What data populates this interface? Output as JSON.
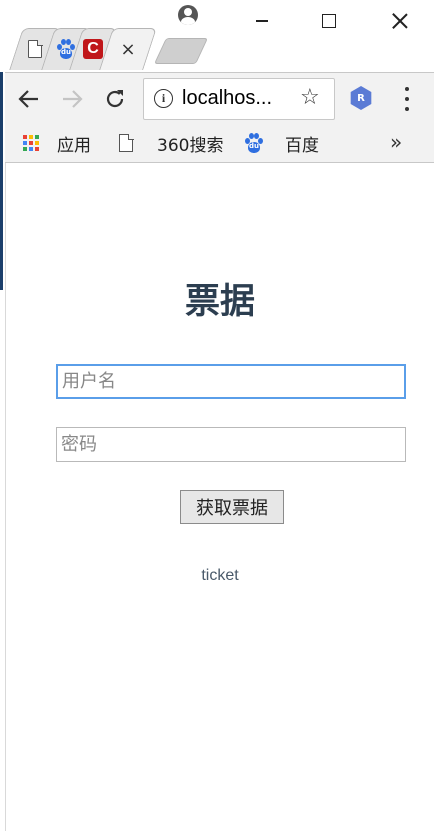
{
  "browser": {
    "url": "localhos...",
    "extension_label": "R",
    "window_controls": [
      "minimize",
      "maximize",
      "close"
    ],
    "tabs": [
      {
        "icon": "file-icon"
      },
      {
        "icon": "baidu-paw-icon"
      },
      {
        "icon": "c-logo-icon"
      },
      {
        "icon": "active-tab",
        "close_label": "×"
      }
    ],
    "bookmarks": [
      {
        "icon": "apps-grid-icon",
        "label": "应用"
      },
      {
        "icon": "file-icon",
        "label": "360搜索"
      },
      {
        "icon": "baidu-paw-icon",
        "label": "百度"
      }
    ],
    "more_bookmarks": "»"
  },
  "page": {
    "title": "票据",
    "username_placeholder": "用户名",
    "password_placeholder": "密码",
    "submit_label": "获取票据",
    "result": "ticket"
  },
  "colors": {
    "title": "#2c3e50",
    "focus_border": "#5a9ee9",
    "chrome_bg": "#f2f2f2",
    "result_text": "#4a5a6a"
  }
}
